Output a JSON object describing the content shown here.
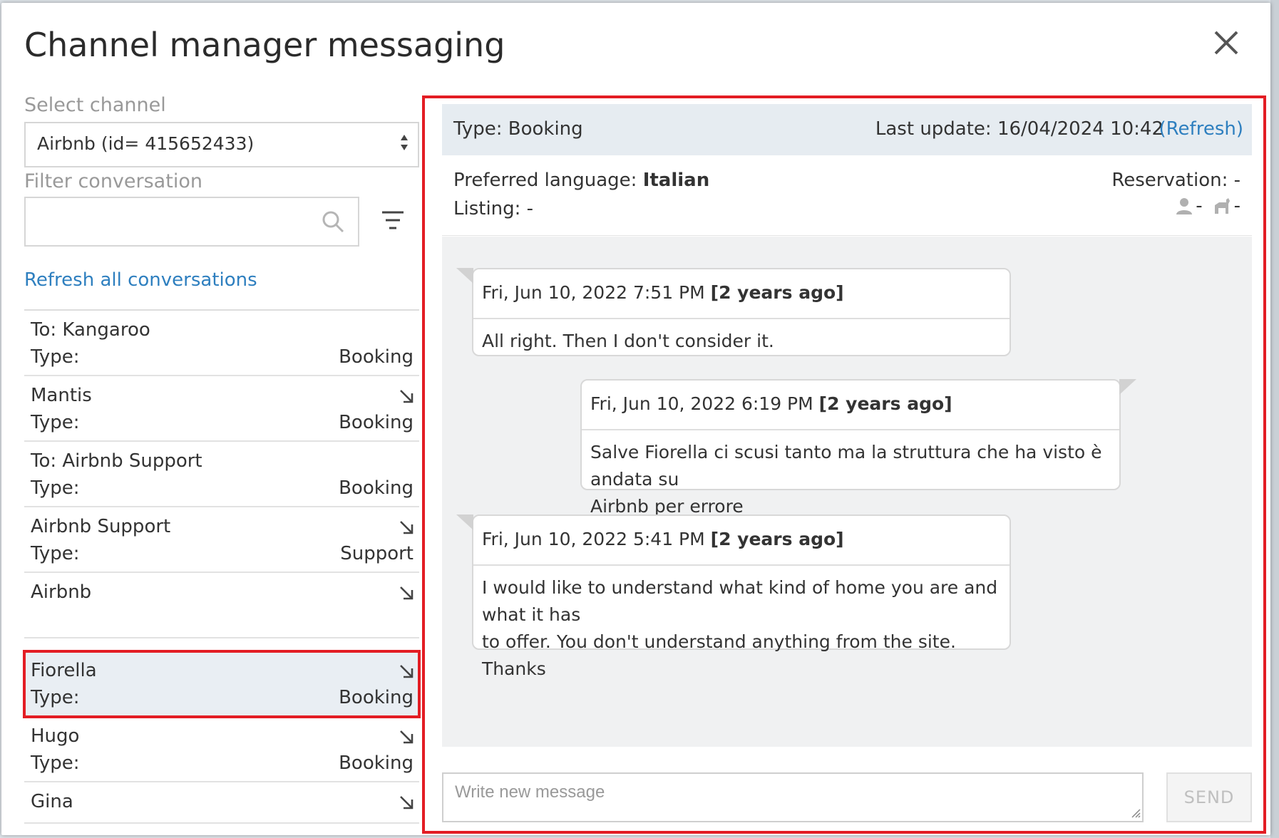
{
  "modal": {
    "title": "Channel manager messaging"
  },
  "left": {
    "select_channel_label": "Select channel",
    "channel_value": "Airbnb (id= 415652433)",
    "filter_label": "Filter conversation",
    "filter_value": "",
    "refresh_all": "Refresh all conversations",
    "type_label": "Type:",
    "conversations": [
      {
        "name": "To: Kangaroo",
        "type": "Booking",
        "arrow": false,
        "selected": false
      },
      {
        "name": "Mantis",
        "type": "Booking",
        "arrow": true,
        "selected": false
      },
      {
        "name": "To: Airbnb Support",
        "type": "Booking",
        "arrow": false,
        "selected": false
      },
      {
        "name": "Airbnb Support",
        "type": "Support",
        "arrow": true,
        "selected": false
      },
      {
        "name": "Airbnb",
        "type": "",
        "arrow": true,
        "selected": false
      },
      {
        "name": "Fiorella",
        "type": "Booking",
        "arrow": true,
        "selected": true
      },
      {
        "name": "Hugo",
        "type": "Booking",
        "arrow": true,
        "selected": false
      },
      {
        "name": "Gina",
        "type": "",
        "arrow": true,
        "selected": false
      }
    ]
  },
  "right": {
    "type_text": "Type: Booking",
    "last_update": "Last update: 16/04/2024 10:42",
    "refresh": "(Refresh)",
    "preferred_language_label": "Preferred language:",
    "preferred_language": "Italian",
    "listing": "Listing: -",
    "reservation": "Reservation: -",
    "guest_value": "-",
    "pet_value": "-",
    "messages": [
      {
        "date": "Fri, Jun 10, 2022 7:51 PM",
        "ago": "[2 years ago]",
        "lines": [
          "All right. Then I don't consider it."
        ],
        "side": "left"
      },
      {
        "date": "Fri, Jun 10, 2022 6:19 PM",
        "ago": "[2 years ago]",
        "lines": [
          "Salve Fiorella ci scusi tanto ma la struttura che ha visto è andata su",
          "Airbnb per errore"
        ],
        "side": "right"
      },
      {
        "date": "Fri, Jun 10, 2022 5:41 PM",
        "ago": "[2 years ago]",
        "lines": [
          "I would like to understand what kind of home you are and what it has",
          "to offer. You don't understand anything from the site.",
          "Thanks"
        ],
        "side": "left"
      }
    ],
    "compose_placeholder": "Write new message",
    "send_label": "SEND"
  },
  "colors": {
    "accent": "#2e7fbf",
    "highlight": "#e31d24",
    "thread_bg": "#f0f1f2",
    "header_bg": "#e6ecf1"
  },
  "icons": [
    "close-icon",
    "select-arrows-icon",
    "search-icon",
    "filter-icon",
    "expand-arrow-icon",
    "guest-icon",
    "pet-icon",
    "resize-grip-icon"
  ]
}
